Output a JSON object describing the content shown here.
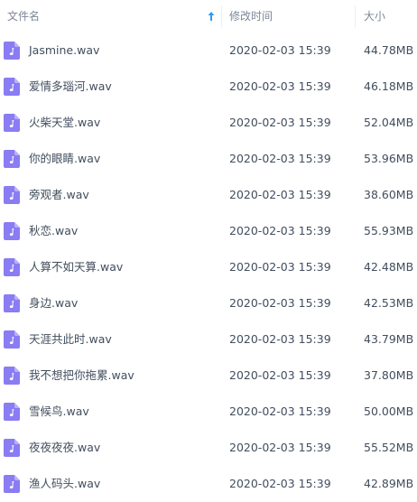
{
  "header": {
    "name_label": "文件名",
    "date_label": "修改时间",
    "size_label": "大小",
    "sort_indicator": "arrow-up-icon",
    "accent_color": "#2e9bf0"
  },
  "icon": {
    "name": "music-file-icon",
    "color": "#8a7cf2"
  },
  "files": [
    {
      "name": "Jasmine.wav",
      "modified": "2020-02-03 15:39",
      "size": "44.78MB"
    },
    {
      "name": "爱情多瑙河.wav",
      "modified": "2020-02-03 15:39",
      "size": "46.18MB"
    },
    {
      "name": "火柴天堂.wav",
      "modified": "2020-02-03 15:39",
      "size": "52.04MB"
    },
    {
      "name": "你的眼睛.wav",
      "modified": "2020-02-03 15:39",
      "size": "53.96MB"
    },
    {
      "name": "旁观者.wav",
      "modified": "2020-02-03 15:39",
      "size": "38.60MB"
    },
    {
      "name": "秋恋.wav",
      "modified": "2020-02-03 15:39",
      "size": "55.93MB"
    },
    {
      "name": "人算不如天算.wav",
      "modified": "2020-02-03 15:39",
      "size": "42.48MB"
    },
    {
      "name": "身边.wav",
      "modified": "2020-02-03 15:39",
      "size": "42.53MB"
    },
    {
      "name": "天涯共此时.wav",
      "modified": "2020-02-03 15:39",
      "size": "43.79MB"
    },
    {
      "name": "我不想把你拖累.wav",
      "modified": "2020-02-03 15:39",
      "size": "37.80MB"
    },
    {
      "name": "雪候鸟.wav",
      "modified": "2020-02-03 15:39",
      "size": "50.00MB"
    },
    {
      "name": "夜夜夜夜.wav",
      "modified": "2020-02-03 15:39",
      "size": "55.52MB"
    },
    {
      "name": "渔人码头.wav",
      "modified": "2020-02-03 15:39",
      "size": "42.89MB"
    }
  ]
}
